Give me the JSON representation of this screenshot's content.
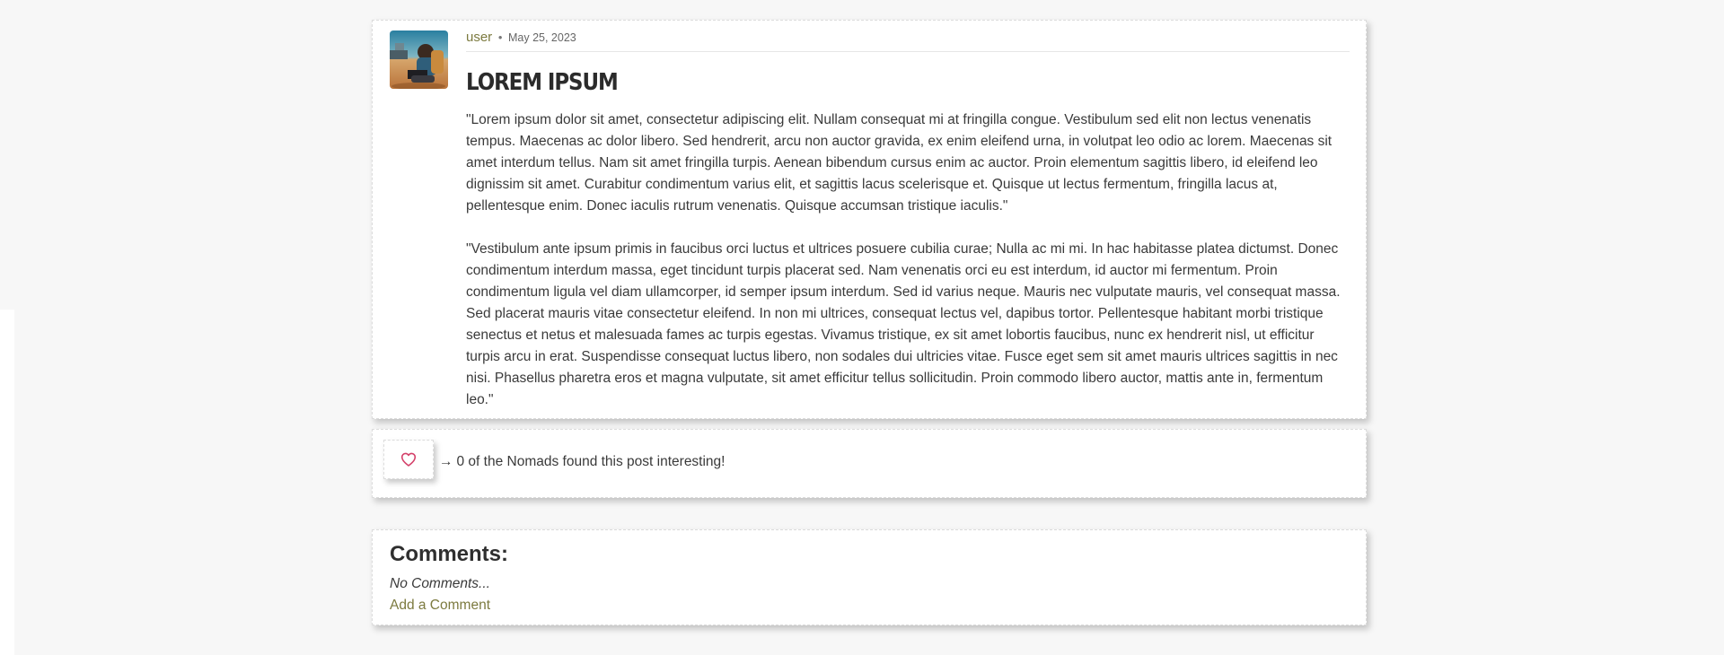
{
  "post": {
    "author": "user",
    "separator": "•",
    "date": "May 25, 2023",
    "title": "LOREM IPSUM",
    "paragraphs": [
      "\"Lorem ipsum dolor sit amet, consectetur adipiscing elit. Nullam consequat mi at fringilla congue. Vestibulum sed elit non lectus venenatis tempus. Maecenas ac dolor libero. Sed hendrerit, arcu non auctor gravida, ex enim eleifend urna, in volutpat leo odio ac lorem. Maecenas sit amet interdum tellus. Nam sit amet fringilla turpis. Aenean bibendum cursus enim ac auctor. Proin elementum sagittis libero, id eleifend leo dignissim sit amet. Curabitur condimentum varius elit, et sagittis lacus scelerisque et. Quisque ut lectus fermentum, fringilla lacus at, pellentesque enim. Donec iaculis rutrum venenatis. Quisque accumsan tristique iaculis.\"",
      "\"Vestibulum ante ipsum primis in faucibus orci luctus et ultrices posuere cubilia curae; Nulla ac mi mi. In hac habitasse platea dictumst. Donec condimentum interdum massa, eget tincidunt turpis placerat sed. Nam venenatis orci eu est interdum, id auctor mi fermentum. Proin condimentum ligula vel diam ullamcorper, id semper ipsum interdum. Sed id varius neque. Mauris nec vulputate mauris, vel consequat massa. Sed placerat mauris vitae consectetur eleifend. In non mi ultrices, consequat lectus vel, dapibus tortor. Pellentesque habitant morbi tristique senectus et netus et malesuada fames ac turpis egestas. Vivamus tristique, ex sit amet lobortis faucibus, nunc ex hendrerit nisl, ut efficitur turpis arcu in erat. Suspendisse consequat luctus libero, non sodales dui ultricies vitae. Fusce eget sem sit amet mauris ultrices sagittis in nec nisi. Phasellus pharetra eros et magna vulputate, sit amet efficitur tellus sollicitudin. Proin commodo libero auctor, mattis ante in, fermentum leo.\""
    ]
  },
  "like": {
    "icon": "heart-icon",
    "arrow": "→",
    "text": "0 of the Nomads found this post interesting!"
  },
  "comments": {
    "title": "Comments:",
    "empty_text": "No Comments...",
    "add_link": "Add a Comment"
  },
  "colors": {
    "accent": "#7c7a3f",
    "heart": "#d4416a",
    "background": "#f7f7f7"
  }
}
